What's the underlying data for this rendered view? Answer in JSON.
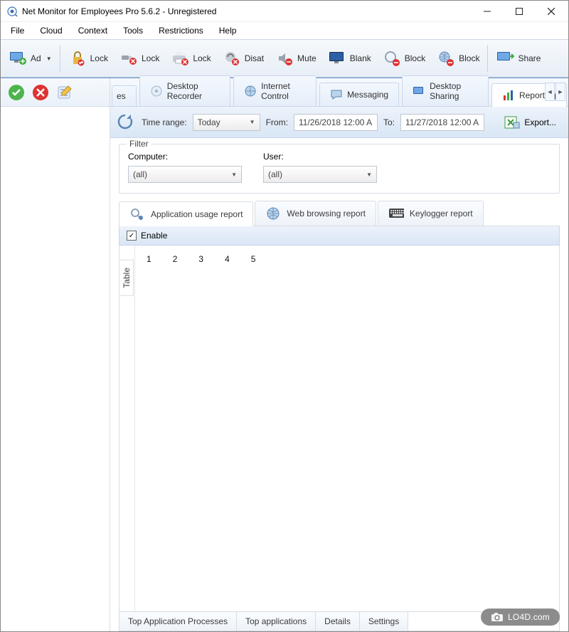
{
  "window": {
    "title": "Net Monitor for Employees Pro 5.6.2 - Unregistered"
  },
  "menu": [
    "File",
    "Cloud",
    "Context",
    "Tools",
    "Restrictions",
    "Help"
  ],
  "toolbar": {
    "add": "Ad",
    "lock1": "Lock",
    "lock2": "Lock",
    "lock3": "Lock",
    "disable": "Disat",
    "mute": "Mute",
    "blank": "Blank",
    "block1": "Block",
    "block2": "Block",
    "share": "Share"
  },
  "bigtabs": {
    "partial": "es",
    "recorder": "Desktop Recorder",
    "internet": "Internet Control",
    "messaging": "Messaging",
    "sharing": "Desktop Sharing",
    "reporting": "Reporting"
  },
  "timebar": {
    "label": "Time range:",
    "range_value": "Today",
    "from_label": "From:",
    "from_value": "11/26/2018 12:00 A",
    "to_label": "To:",
    "to_value": "11/27/2018 12:00 A",
    "export": "Export..."
  },
  "filter": {
    "title": "Filter",
    "computer_label": "Computer:",
    "computer_value": "(all)",
    "user_label": "User:",
    "user_value": "(all)"
  },
  "rtabs": {
    "app": "Application usage report",
    "web": "Web browsing report",
    "key": "Keylogger report"
  },
  "enable": {
    "label": "Enable",
    "checked": true
  },
  "table": {
    "side_label": "Table",
    "cols": [
      "1",
      "2",
      "3",
      "4",
      "5"
    ]
  },
  "bottom_tabs": [
    "Top Application Processes",
    "Top applications",
    "Details",
    "Settings"
  ],
  "watermark": "LO4D.com"
}
